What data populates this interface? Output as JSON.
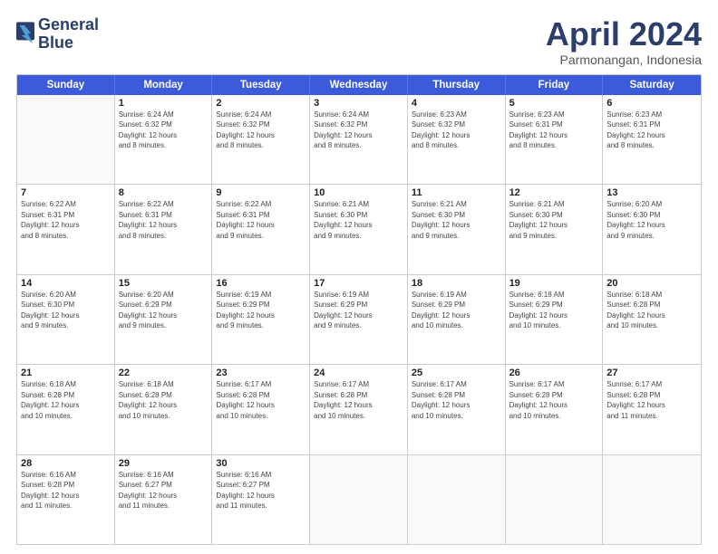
{
  "header": {
    "logo_line1": "General",
    "logo_line2": "Blue",
    "month": "April 2024",
    "location": "Parmonangan, Indonesia"
  },
  "days_of_week": [
    "Sunday",
    "Monday",
    "Tuesday",
    "Wednesday",
    "Thursday",
    "Friday",
    "Saturday"
  ],
  "weeks": [
    [
      {
        "num": "",
        "info": ""
      },
      {
        "num": "1",
        "info": "Sunrise: 6:24 AM\nSunset: 6:32 PM\nDaylight: 12 hours\nand 8 minutes."
      },
      {
        "num": "2",
        "info": "Sunrise: 6:24 AM\nSunset: 6:32 PM\nDaylight: 12 hours\nand 8 minutes."
      },
      {
        "num": "3",
        "info": "Sunrise: 6:24 AM\nSunset: 6:32 PM\nDaylight: 12 hours\nand 8 minutes."
      },
      {
        "num": "4",
        "info": "Sunrise: 6:23 AM\nSunset: 6:32 PM\nDaylight: 12 hours\nand 8 minutes."
      },
      {
        "num": "5",
        "info": "Sunrise: 6:23 AM\nSunset: 6:31 PM\nDaylight: 12 hours\nand 8 minutes."
      },
      {
        "num": "6",
        "info": "Sunrise: 6:23 AM\nSunset: 6:31 PM\nDaylight: 12 hours\nand 8 minutes."
      }
    ],
    [
      {
        "num": "7",
        "info": "Sunrise: 6:22 AM\nSunset: 6:31 PM\nDaylight: 12 hours\nand 8 minutes."
      },
      {
        "num": "8",
        "info": "Sunrise: 6:22 AM\nSunset: 6:31 PM\nDaylight: 12 hours\nand 8 minutes."
      },
      {
        "num": "9",
        "info": "Sunrise: 6:22 AM\nSunset: 6:31 PM\nDaylight: 12 hours\nand 9 minutes."
      },
      {
        "num": "10",
        "info": "Sunrise: 6:21 AM\nSunset: 6:30 PM\nDaylight: 12 hours\nand 9 minutes."
      },
      {
        "num": "11",
        "info": "Sunrise: 6:21 AM\nSunset: 6:30 PM\nDaylight: 12 hours\nand 9 minutes."
      },
      {
        "num": "12",
        "info": "Sunrise: 6:21 AM\nSunset: 6:30 PM\nDaylight: 12 hours\nand 9 minutes."
      },
      {
        "num": "13",
        "info": "Sunrise: 6:20 AM\nSunset: 6:30 PM\nDaylight: 12 hours\nand 9 minutes."
      }
    ],
    [
      {
        "num": "14",
        "info": "Sunrise: 6:20 AM\nSunset: 6:30 PM\nDaylight: 12 hours\nand 9 minutes."
      },
      {
        "num": "15",
        "info": "Sunrise: 6:20 AM\nSunset: 6:29 PM\nDaylight: 12 hours\nand 9 minutes."
      },
      {
        "num": "16",
        "info": "Sunrise: 6:19 AM\nSunset: 6:29 PM\nDaylight: 12 hours\nand 9 minutes."
      },
      {
        "num": "17",
        "info": "Sunrise: 6:19 AM\nSunset: 6:29 PM\nDaylight: 12 hours\nand 9 minutes."
      },
      {
        "num": "18",
        "info": "Sunrise: 6:19 AM\nSunset: 6:29 PM\nDaylight: 12 hours\nand 10 minutes."
      },
      {
        "num": "19",
        "info": "Sunrise: 6:18 AM\nSunset: 6:29 PM\nDaylight: 12 hours\nand 10 minutes."
      },
      {
        "num": "20",
        "info": "Sunrise: 6:18 AM\nSunset: 6:28 PM\nDaylight: 12 hours\nand 10 minutes."
      }
    ],
    [
      {
        "num": "21",
        "info": "Sunrise: 6:18 AM\nSunset: 6:28 PM\nDaylight: 12 hours\nand 10 minutes."
      },
      {
        "num": "22",
        "info": "Sunrise: 6:18 AM\nSunset: 6:28 PM\nDaylight: 12 hours\nand 10 minutes."
      },
      {
        "num": "23",
        "info": "Sunrise: 6:17 AM\nSunset: 6:28 PM\nDaylight: 12 hours\nand 10 minutes."
      },
      {
        "num": "24",
        "info": "Sunrise: 6:17 AM\nSunset: 6:28 PM\nDaylight: 12 hours\nand 10 minutes."
      },
      {
        "num": "25",
        "info": "Sunrise: 6:17 AM\nSunset: 6:28 PM\nDaylight: 12 hours\nand 10 minutes."
      },
      {
        "num": "26",
        "info": "Sunrise: 6:17 AM\nSunset: 6:28 PM\nDaylight: 12 hours\nand 10 minutes."
      },
      {
        "num": "27",
        "info": "Sunrise: 6:17 AM\nSunset: 6:28 PM\nDaylight: 12 hours\nand 11 minutes."
      }
    ],
    [
      {
        "num": "28",
        "info": "Sunrise: 6:16 AM\nSunset: 6:28 PM\nDaylight: 12 hours\nand 11 minutes."
      },
      {
        "num": "29",
        "info": "Sunrise: 6:16 AM\nSunset: 6:27 PM\nDaylight: 12 hours\nand 11 minutes."
      },
      {
        "num": "30",
        "info": "Sunrise: 6:16 AM\nSunset: 6:27 PM\nDaylight: 12 hours\nand 11 minutes."
      },
      {
        "num": "",
        "info": ""
      },
      {
        "num": "",
        "info": ""
      },
      {
        "num": "",
        "info": ""
      },
      {
        "num": "",
        "info": ""
      }
    ]
  ]
}
